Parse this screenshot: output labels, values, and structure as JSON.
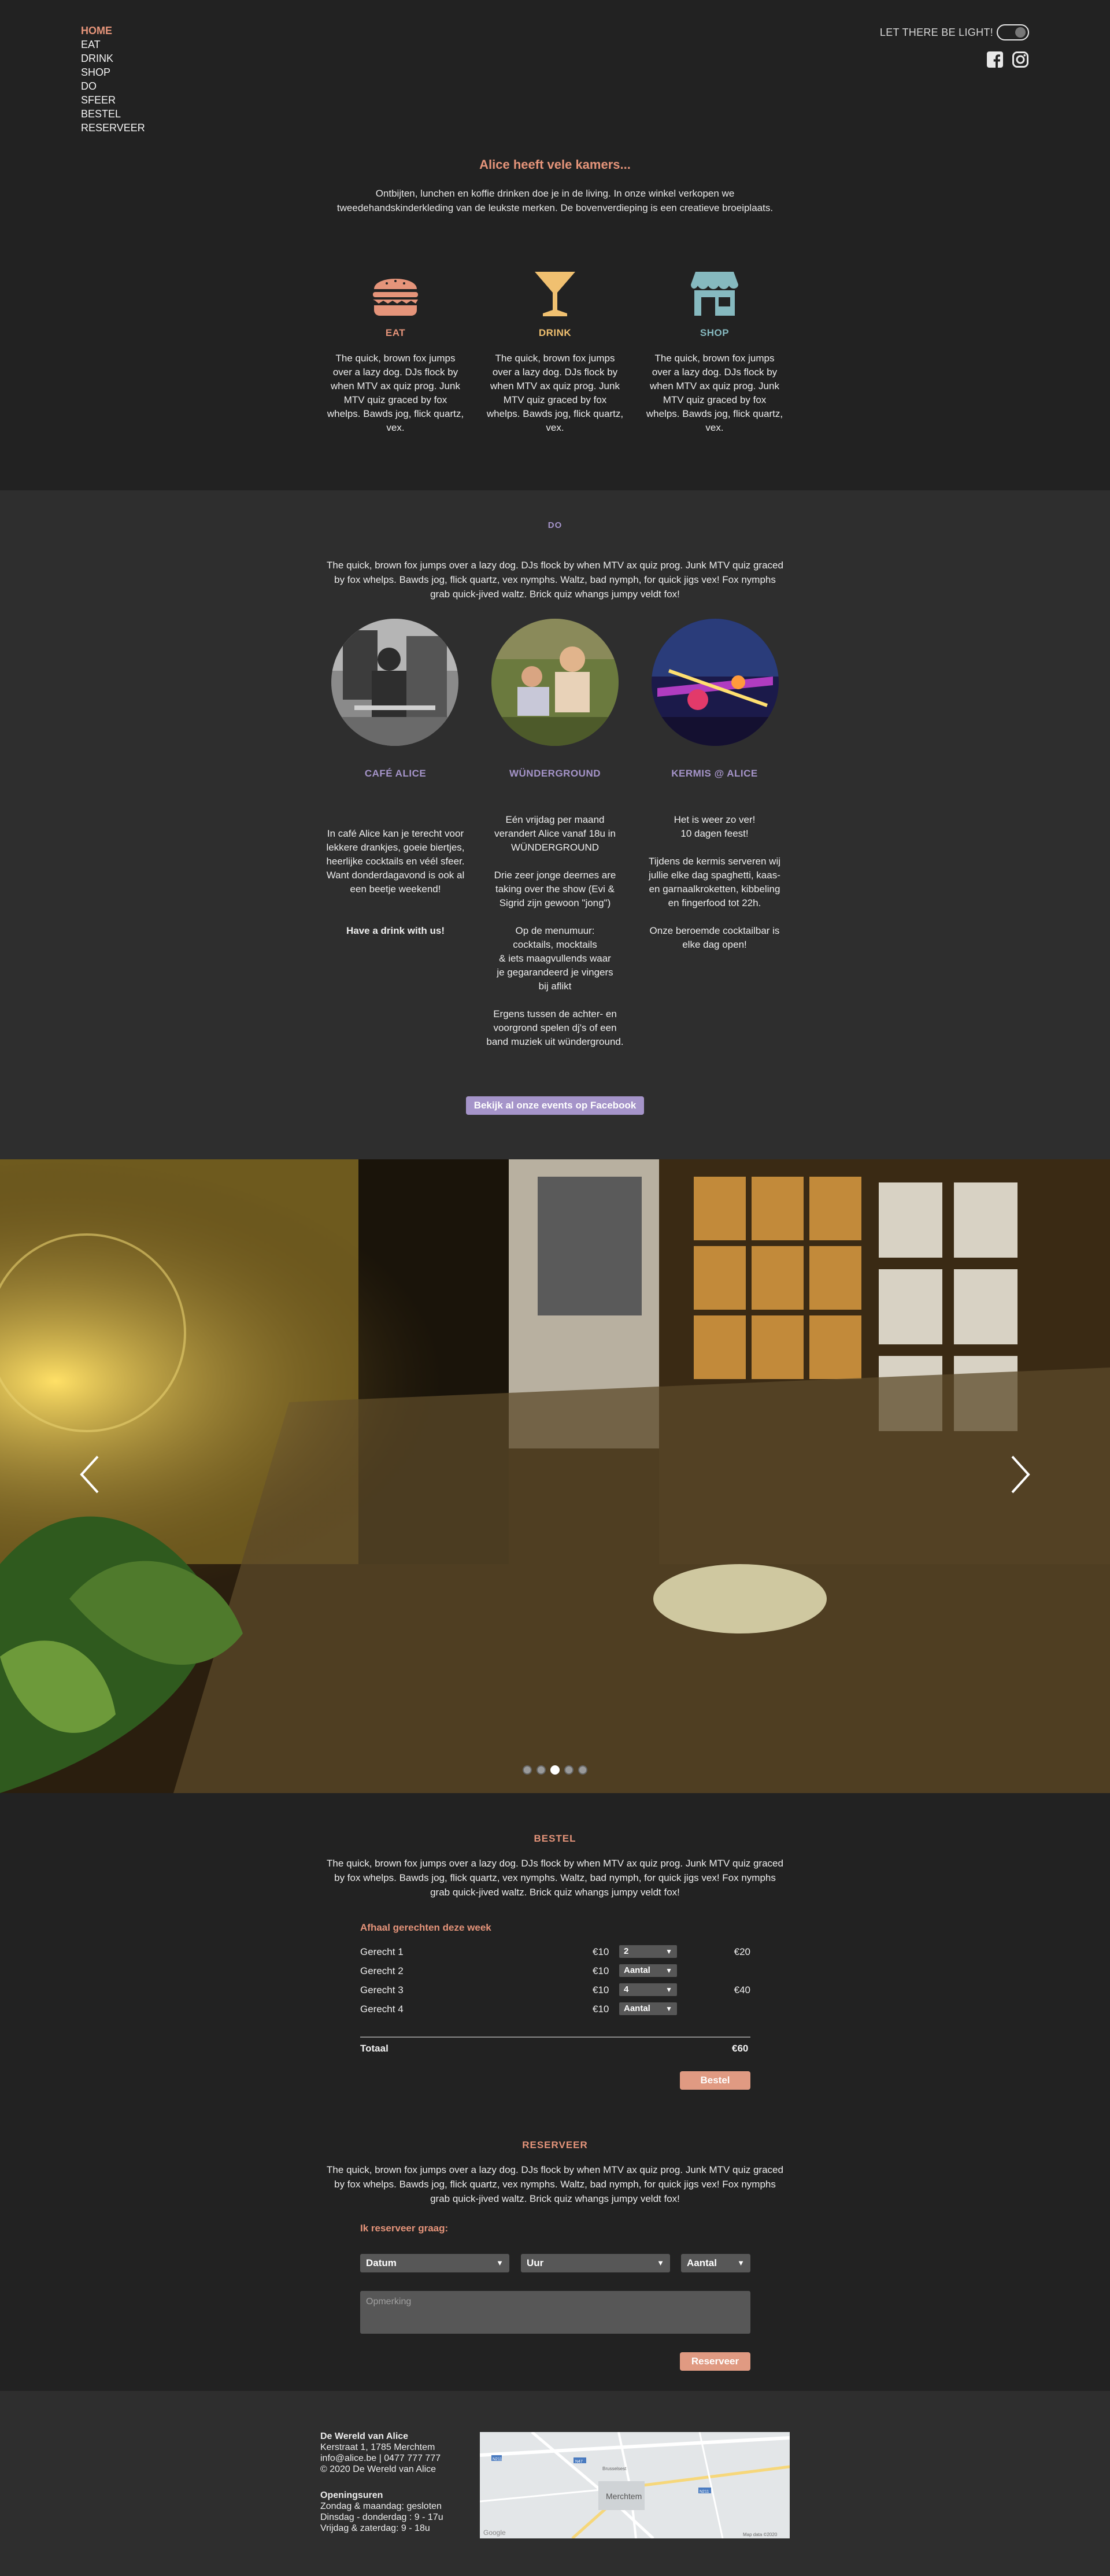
{
  "nav": {
    "items": [
      "HOME",
      "EAT",
      "DRINK",
      "SHOP",
      "DO",
      "SFEER",
      "BESTEL",
      "RESERVEER"
    ],
    "active": "HOME"
  },
  "header": {
    "light_label": "LET THERE BE LIGHT!",
    "facebook_icon": "facebook-square-icon",
    "instagram_icon": "instagram-icon"
  },
  "intro": {
    "title": "Alice heeft vele kamers...",
    "text": "Ontbijten, lunchen en koffie drinken doe je in de living.  In onze winkel verkopen we tweedehandskinderkleding van de leukste merken. De bovenverdieping is een creatieve broeiplaats."
  },
  "features": [
    {
      "title": "EAT",
      "icon": "burger-icon",
      "color": "#e5947a",
      "text": "The quick, brown fox jumps over a lazy dog. DJs flock by when MTV ax quiz prog. Junk MTV quiz graced by fox whelps. Bawds jog, flick quartz, vex."
    },
    {
      "title": "DRINK",
      "icon": "cocktail-glass-icon",
      "color": "#f0c070",
      "text": "The quick, brown fox jumps over a lazy dog. DJs flock by when MTV ax quiz prog. Junk MTV quiz graced by fox whelps. Bawds jog, flick quartz, vex."
    },
    {
      "title": "SHOP",
      "icon": "store-icon",
      "color": "#86b9bf",
      "text": "The quick, brown fox jumps over a lazy dog. DJs flock by when MTV ax quiz prog. Junk MTV quiz graced by fox whelps. Bawds jog, flick quartz, vex."
    }
  ],
  "do": {
    "title": "DO",
    "text": "The quick, brown fox jumps over a lazy dog. DJs flock by when MTV ax quiz prog. Junk MTV quiz graced by fox whelps. Bawds jog, flick quartz, vex nymphs. Waltz, bad nymph, for quick jigs vex! Fox nymphs grab quick-jived waltz. Brick quiz whangs jumpy veldt fox!",
    "columns": [
      {
        "title": "CAFÉ ALICE",
        "text": "In café Alice kan je terecht voor lekkere drankjes, goeie biertjes, heerlijke cocktails en véél sfeer.\nWant donderdagavond is ook al een beetje weekend!",
        "cta": "Have a drink with us!"
      },
      {
        "title": "WÜNDERGROUND",
        "text": "Eén vrijdag per maand verandert Alice vanaf 18u in WÜNDERGROUND\n\nDrie zeer jonge deernes are taking over the show (Evi & Sigrid zijn gewoon \"jong\")\n\nOp de menumuur:\ncocktails, mocktails\n& iets maagvullends waar\nje gegarandeerd je vingers\nbij aflikt\n\nErgens tussen de achter- en voorgrond spelen dj's of een band muziek uit wünderground."
      },
      {
        "title": "KERMIS @ ALICE",
        "text": "Het is weer zo ver!\n10 dagen feest!\n\nTijdens de kermis serveren wij jullie elke dag spaghetti, kaas- en garnaalkroketten, kibbeling en fingerfood tot 22h.\n\nOnze beroemde cocktailbar is elke dag open!"
      }
    ],
    "button": "Bekijk al onze events op Facebook"
  },
  "slider": {
    "prev_icon": "chevron-left-icon",
    "next_icon": "chevron-right-icon",
    "slide_count": 5,
    "active_index": 2
  },
  "bestel": {
    "title": "BESTEL",
    "text": "The quick, brown fox jumps over a lazy dog. DJs flock by when MTV ax quiz prog. Junk MTV quiz graced by fox whelps. Bawds jog, flick quartz, vex nymphs. Waltz, bad nymph, for quick jigs vex! Fox nymphs grab quick-jived waltz. Brick quiz whangs jumpy veldt fox!",
    "subtitle": "Afhaal gerechten deze week",
    "rows": [
      {
        "name": "Gerecht 1",
        "price": "€10",
        "qty": "2",
        "subtotal": "€20"
      },
      {
        "name": "Gerecht 2",
        "price": "€10",
        "qty": "Aantal",
        "subtotal": ""
      },
      {
        "name": "Gerecht 3",
        "price": "€10",
        "qty": "4",
        "subtotal": "€40"
      },
      {
        "name": "Gerecht 4",
        "price": "€10",
        "qty": "Aantal",
        "subtotal": ""
      }
    ],
    "total_label": "Totaal",
    "total_value": "€60",
    "button": "Bestel"
  },
  "reserveer": {
    "title": "RESERVEER",
    "text": "The quick, brown fox jumps over a lazy dog. DJs flock by when MTV ax quiz prog. Junk MTV quiz graced by fox whelps. Bawds jog, flick quartz, vex nymphs. Waltz, bad nymph, for quick jigs vex! Fox nymphs grab quick-jived waltz. Brick quiz whangs jumpy veldt fox!",
    "subtitle": "Ik reserveer graag:",
    "date_select": "Datum",
    "time_select": "Uur",
    "count_select": "Aantal",
    "remark_placeholder": "Opmerking",
    "button": "Reserveer"
  },
  "footer": {
    "name": "De Wereld van Alice",
    "address": "Kerstraat 1, 1785 Merchtem",
    "contact": "info@alice.be | 0477 777 777",
    "copyright": "© 2020 De Wereld van Alice",
    "hours_title": "Openingsuren",
    "hours": [
      "Zondag & maandag: gesloten",
      "Dinsdag - donderdag : 9 - 17u",
      "Vrijdag & zaterdag: 9 - 18u"
    ],
    "map": {
      "town": "Merchtem",
      "roads": [
        "N211",
        "N47",
        "N211"
      ],
      "place": "Brusselsest",
      "attribution": "Map data ©2020",
      "logo": "Google"
    }
  },
  "colors": {
    "accent": "#e5947a",
    "do_accent": "#a594c9",
    "eat": "#e5947a",
    "drink": "#f0c070",
    "shop": "#86b9bf"
  }
}
